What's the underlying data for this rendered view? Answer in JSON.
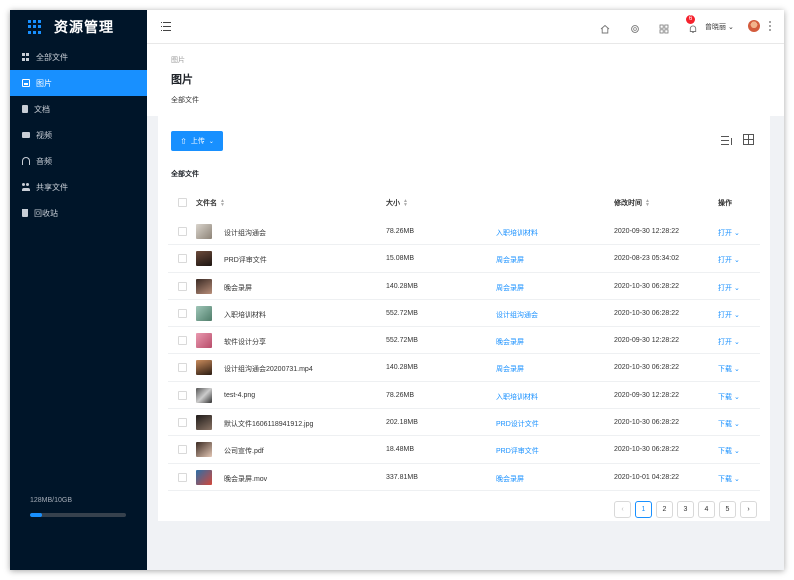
{
  "sidebar": {
    "title": "资源管理",
    "items": [
      {
        "label": "全部文件",
        "icon": "grid-icon"
      },
      {
        "label": "图片",
        "icon": "image-icon"
      },
      {
        "label": "文档",
        "icon": "document-icon"
      },
      {
        "label": "视频",
        "icon": "video-icon"
      },
      {
        "label": "音频",
        "icon": "headphones-icon"
      },
      {
        "label": "共享文件",
        "icon": "users-icon"
      },
      {
        "label": "回收站",
        "icon": "trash-icon"
      }
    ],
    "active_index": 1,
    "storage": {
      "text": "128MB/10GB",
      "used_fraction": 0.12
    }
  },
  "header": {
    "username": "曾晓丽",
    "notification_count": "6",
    "icons": [
      "menu-icon",
      "home-icon",
      "support-icon",
      "apps-icon",
      "bell-icon",
      "more-icon"
    ]
  },
  "page": {
    "breadcrumb": "图片",
    "title": "图片",
    "subtitle": "全部文件"
  },
  "toolbar": {
    "upload_label": "上传",
    "section_title": "全部文件"
  },
  "table": {
    "columns": {
      "name": "文件名",
      "size": "大小",
      "time": "修改时间",
      "action": "操作"
    },
    "rows": [
      {
        "name": "设计组沟通会",
        "size": "78.26MB",
        "tag": "入职培训材料",
        "time": "2020-09-30  12:28:22",
        "action": "打开"
      },
      {
        "name": "PRD评审文件",
        "size": "15.08MB",
        "tag": "周会录屏",
        "time": "2020-08-23 05:34:02",
        "action": "打开"
      },
      {
        "name": "晚会录屏",
        "size": "140.28MB",
        "tag": "周会录屏",
        "time": "2020-10-30  06:28:22",
        "action": "打开"
      },
      {
        "name": "入职培训材料",
        "size": "552.72MB",
        "tag": "设计组沟通会",
        "time": "2020-10-30  06:28:22",
        "action": "打开"
      },
      {
        "name": "软件设计分享",
        "size": "552.72MB",
        "tag": "晚会录屏",
        "time": "2020-09-30  12:28:22",
        "action": "打开"
      },
      {
        "name": "设计组沟通会20200731.mp4",
        "size": "140.28MB",
        "tag": "周会录屏",
        "time": "2020-10-30  06:28:22",
        "action": "下载"
      },
      {
        "name": "test-4.png",
        "size": "78.26MB",
        "tag": "入职培训材料",
        "time": "2020-09-30  12:28:22",
        "action": "下载"
      },
      {
        "name": "默认文件1606118941912.jpg",
        "size": "202.18MB",
        "tag": "PRD设计文件",
        "time": "2020-10-30  06:28:22",
        "action": "下载"
      },
      {
        "name": "公司宣传.pdf",
        "size": "18.48MB",
        "tag": "PRD评审文件",
        "time": "2020-10-30  06:28:22",
        "action": "下载"
      },
      {
        "name": "晚会录屏.mov",
        "size": "337.81MB",
        "tag": "晚会录屏",
        "time": "2020-10-01  04:28:22",
        "action": "下载"
      }
    ]
  },
  "pagination": {
    "pages": [
      "1",
      "2",
      "3",
      "4",
      "5"
    ],
    "current": "1"
  },
  "colors": {
    "accent": "#1890ff",
    "sidebar_bg": "#001529",
    "badge": "#f5222d"
  }
}
